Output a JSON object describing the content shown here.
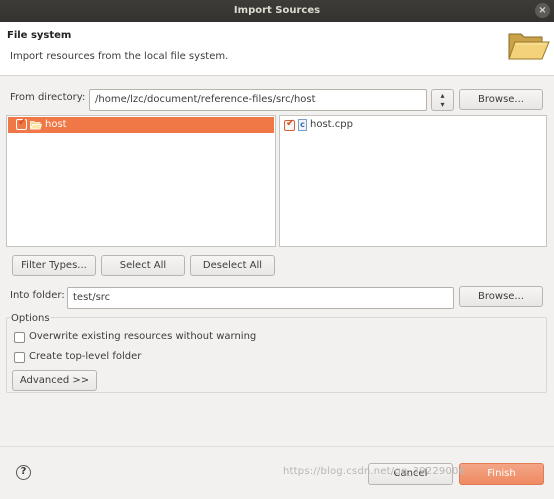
{
  "window": {
    "title": "Import Sources",
    "close_glyph": "×"
  },
  "header": {
    "title": "File system",
    "description": "Import resources from the local file system.",
    "icon": "folder-open-icon"
  },
  "from_directory": {
    "label": "From directory:",
    "value": "/home/lzc/document/reference-files/src/host",
    "stepper_up": "▴",
    "stepper_down": "▾",
    "browse_label": "Browse..."
  },
  "folder_tree": {
    "items": [
      {
        "label": "host",
        "checked": true,
        "selected": true
      }
    ]
  },
  "file_list": {
    "items": [
      {
        "label": "host.cpp",
        "checked": true,
        "icon_glyph": "c"
      }
    ]
  },
  "selection_buttons": {
    "filter_types": "Filter Types...",
    "select_all": "Select All",
    "deselect_all": "Deselect All"
  },
  "into_folder": {
    "label": "Into folder:",
    "value": "test/src",
    "browse_label": "Browse..."
  },
  "options": {
    "legend": "Options",
    "overwrite_label": "Overwrite existing resources without warning",
    "overwrite_checked": false,
    "toplevel_label": "Create top-level folder",
    "toplevel_checked": false,
    "advanced_label": "Advanced >>"
  },
  "footer": {
    "help_glyph": "?",
    "cancel_label": "Cancel",
    "finish_label": "Finish",
    "watermark": "https://blog.csdn.net/qq_39229006"
  },
  "colors": {
    "accent": "#f07746",
    "title_bar": "#3a3935"
  }
}
